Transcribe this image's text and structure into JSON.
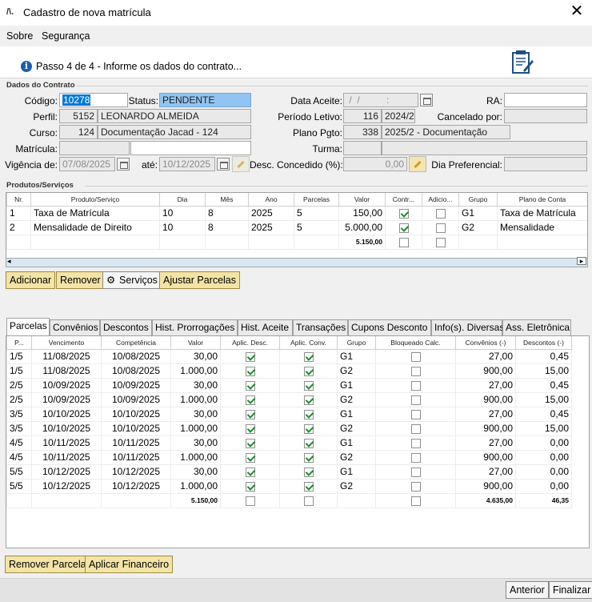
{
  "window": {
    "title": "Cadastro de nova matrícula",
    "close": "✕"
  },
  "menu": {
    "sobre": "Sobre",
    "seguranca": "Segurança"
  },
  "step": {
    "text": "Passo 4 de 4 - Informe os dados do contrato..."
  },
  "contrato": {
    "section_label": "Dados do Contrato",
    "codigo_label": "Código:",
    "codigo": "10278",
    "status_label": "Status:",
    "status": "PENDENTE",
    "data_aceite_label": "Data Aceite:",
    "data_aceite": " /  /          :",
    "ra_label": "RA:",
    "ra": "",
    "perfil_label": "Perfil:",
    "perfil_code": "5152",
    "perfil_name": "LEONARDO ALMEIDA",
    "periodo_label": "Período Letivo:",
    "periodo_code": "116",
    "periodo": "2024/2",
    "cancelado_label": "Cancelado por:",
    "cancelado": "",
    "curso_label": "Curso:",
    "curso_code": "124",
    "curso": "Documentação Jacad - 124",
    "plano_label": "Plano Pgto:",
    "plano_code": "338",
    "plano": "2025/2 - Documentação",
    "matricula_label": "Matrícula:",
    "matricula": "",
    "matricula2": "",
    "turma_label": "Turma:",
    "turma": "",
    "turma2": "",
    "vigencia_label": "Vigência de:",
    "vigencia_de": "07/08/2025",
    "ate_label": "até:",
    "vigencia_ate": "10/12/2025",
    "desc_label": "Desc. Concedido (%):",
    "desc": "0,00",
    "dia_label": "Dia Preferencial:",
    "dia": ""
  },
  "produtos": {
    "section_label": "Produtos/Serviços",
    "headers": [
      "Nr.",
      "Produto/Serviço",
      "Dia",
      "Mês",
      "Ano",
      "Parcelas",
      "Valor",
      "Contr...",
      "Adicio...",
      "Grupo",
      "Plano de Conta"
    ],
    "rows": [
      {
        "nr": "1",
        "produto": "Taxa de Matrícula",
        "dia": "10",
        "mes": "8",
        "ano": "2025",
        "parcelas": "5",
        "valor": "150,00",
        "contr": true,
        "adic": false,
        "grupo": "G1",
        "plano": "Taxa de Matrícula"
      },
      {
        "nr": "2",
        "produto": "Mensalidade de Direito",
        "dia": "10",
        "mes": "8",
        "ano": "2025",
        "parcelas": "5",
        "valor": "5.000,00",
        "contr": true,
        "adic": false,
        "grupo": "G2",
        "plano": "Mensalidade"
      }
    ],
    "total": "5.150,00",
    "buttons": {
      "adicionar": "Adicionar",
      "remover": "Remover",
      "servicos": "Serviços",
      "ajustar": "Ajustar Parcelas"
    }
  },
  "tabs": [
    "Parcelas",
    "Convênios",
    "Descontos",
    "Hist. Prorrogações",
    "Hist. Aceite",
    "Transações",
    "Cupons Desconto",
    "Info(s). Diversas",
    "Ass. Eletrônica"
  ],
  "parcelas": {
    "headers": [
      "P...",
      "Vencimento",
      "Competência",
      "Valor",
      "Aplic. Desc.",
      "Aplic. Conv.",
      "Grupo",
      "Bloqueado Calc.",
      "Convênios (-)",
      "Descontos (-)"
    ],
    "rows": [
      {
        "p": "1/5",
        "venc": "11/08/2025",
        "comp": "10/08/2025",
        "valor": "30,00",
        "grupo": "G1",
        "conv": "27,00",
        "desc": "0,45"
      },
      {
        "p": "1/5",
        "venc": "11/08/2025",
        "comp": "10/08/2025",
        "valor": "1.000,00",
        "grupo": "G2",
        "conv": "900,00",
        "desc": "15,00"
      },
      {
        "p": "2/5",
        "venc": "10/09/2025",
        "comp": "10/09/2025",
        "valor": "30,00",
        "grupo": "G1",
        "conv": "27,00",
        "desc": "0,45"
      },
      {
        "p": "2/5",
        "venc": "10/09/2025",
        "comp": "10/09/2025",
        "valor": "1.000,00",
        "grupo": "G2",
        "conv": "900,00",
        "desc": "15,00"
      },
      {
        "p": "3/5",
        "venc": "10/10/2025",
        "comp": "10/10/2025",
        "valor": "30,00",
        "grupo": "G1",
        "conv": "27,00",
        "desc": "0,45"
      },
      {
        "p": "3/5",
        "venc": "10/10/2025",
        "comp": "10/10/2025",
        "valor": "1.000,00",
        "grupo": "G2",
        "conv": "900,00",
        "desc": "15,00"
      },
      {
        "p": "4/5",
        "venc": "10/11/2025",
        "comp": "10/11/2025",
        "valor": "30,00",
        "grupo": "G1",
        "conv": "27,00",
        "desc": "0,00"
      },
      {
        "p": "4/5",
        "venc": "10/11/2025",
        "comp": "10/11/2025",
        "valor": "1.000,00",
        "grupo": "G2",
        "conv": "900,00",
        "desc": "0,00"
      },
      {
        "p": "5/5",
        "venc": "10/12/2025",
        "comp": "10/12/2025",
        "valor": "30,00",
        "grupo": "G1",
        "conv": "27,00",
        "desc": "0,00"
      },
      {
        "p": "5/5",
        "venc": "10/12/2025",
        "comp": "10/12/2025",
        "valor": "1.000,00",
        "grupo": "G2",
        "conv": "900,00",
        "desc": "0,00"
      }
    ],
    "total_valor": "5.150,00",
    "total_conv": "4.635,00",
    "total_desc": "46,35",
    "buttons": {
      "remover": "Remover Parcela",
      "aplicar": "Aplicar Financeiro"
    }
  },
  "footer": {
    "anterior": "Anterior",
    "finalizar": "Finalizar"
  }
}
